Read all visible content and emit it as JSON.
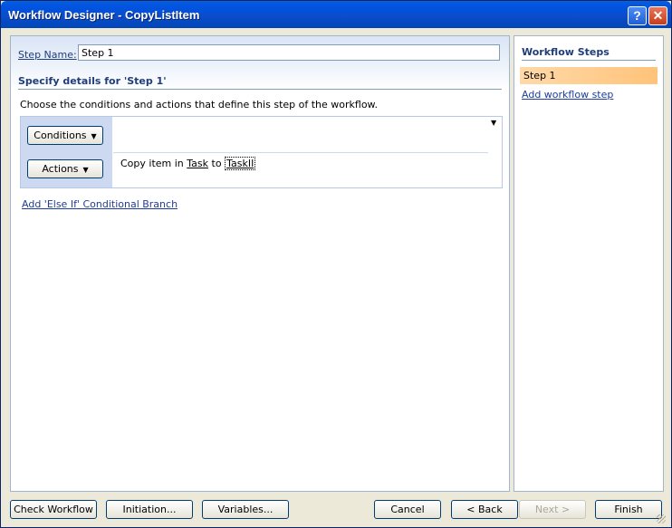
{
  "window": {
    "title": "Workflow Designer - CopyListItem",
    "help_glyph": "?",
    "close_glyph": "✕"
  },
  "step": {
    "name_label": "Step Name:",
    "name_value": "Step 1",
    "details_title": "Specify details for 'Step 1'",
    "description": "Choose the conditions and actions that define this step of the workflow."
  },
  "rule": {
    "conditions_label": "Conditions",
    "actions_label": "Actions",
    "dropdown_glyph": "▼",
    "action_prefix": "Copy item in",
    "action_source": "Task",
    "action_mid": "to",
    "action_target": "TaskII"
  },
  "links": {
    "else_if": "Add 'Else If' Conditional Branch"
  },
  "workflow_steps": {
    "title": "Workflow Steps",
    "items": [
      "Step 1"
    ],
    "add_label": "Add workflow step"
  },
  "footer": {
    "check_workflow": "Check Workflow",
    "initiation": "Initiation...",
    "variables": "Variables...",
    "cancel": "Cancel",
    "back": "< Back",
    "next": "Next >",
    "finish": "Finish"
  },
  "colors": {
    "selected_step": "#ffc37a",
    "link": "#1f3d9a",
    "title_bar": "#0054e3"
  }
}
